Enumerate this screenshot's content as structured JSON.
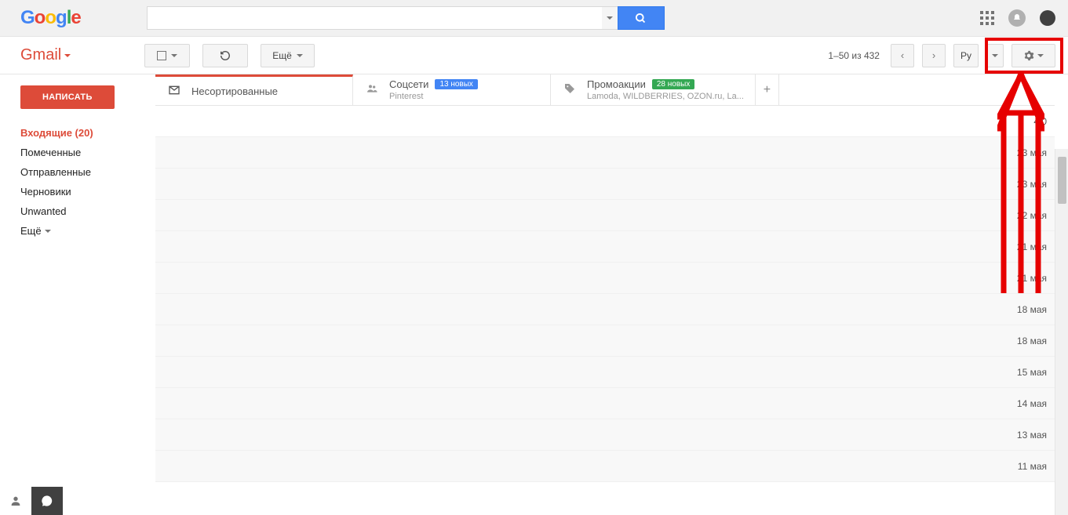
{
  "header": {
    "logo_letters": [
      "G",
      "o",
      "o",
      "g",
      "l",
      "e"
    ]
  },
  "toolbar": {
    "gmail_label": "Gmail",
    "more_label": "Ещё",
    "pagination": "1–50 из 432",
    "lang_label": "Ру"
  },
  "sidebar": {
    "compose": "НАПИСАТЬ",
    "items": [
      {
        "label": "Входящие (20)",
        "active": true
      },
      {
        "label": "Помеченные"
      },
      {
        "label": "Отправленные"
      },
      {
        "label": "Черновики"
      },
      {
        "label": "Unwanted"
      },
      {
        "label": "Ещё",
        "more": true
      }
    ]
  },
  "tabs": [
    {
      "title": "Несортированные",
      "icon": "inbox",
      "active": true
    },
    {
      "title": "Соцсети",
      "icon": "people",
      "badge": "13 новых",
      "badge_color": "blue",
      "sub": "Pinterest"
    },
    {
      "title": "Промоакции",
      "icon": "tag",
      "badge": "28 новых",
      "badge_color": "green",
      "sub": "Lamoda, WILDBERRIES, OZON.ru, La..."
    }
  ],
  "dates": [
    "4:0",
    "23 мая",
    "23 мая",
    "22 мая",
    "21 мая",
    "21 мая",
    "18 мая",
    "18 мая",
    "15 мая",
    "14 мая",
    "13 мая",
    "11 мая"
  ]
}
